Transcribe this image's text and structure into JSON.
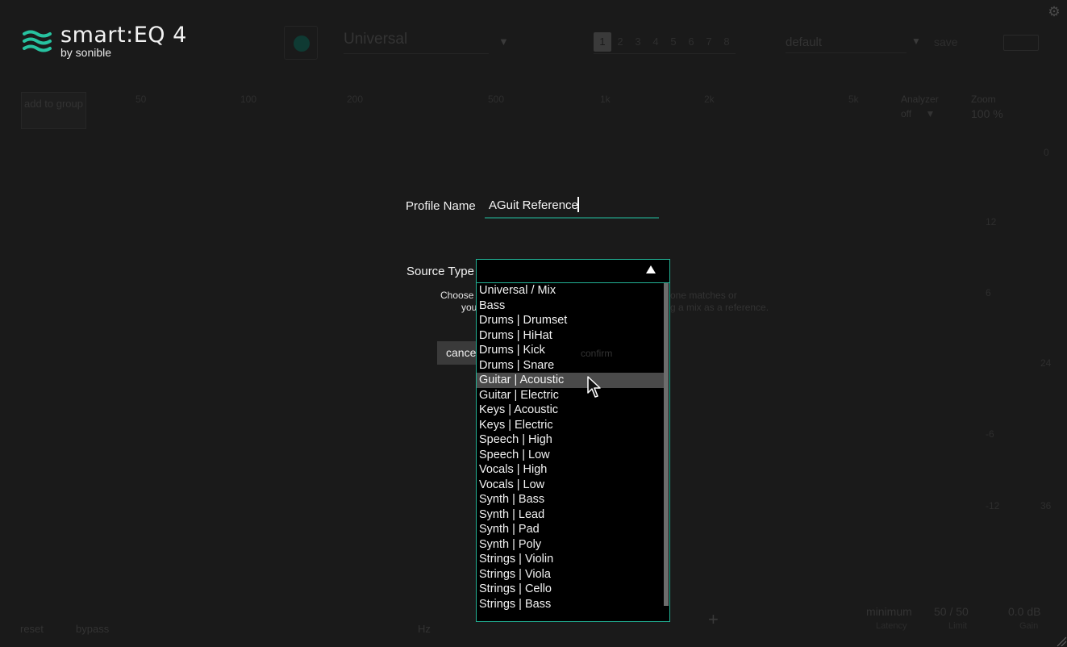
{
  "header": {
    "logo_title": "smart:EQ 4",
    "logo_by": "by sonible",
    "profile": "Universal",
    "slots": [
      "1",
      "2",
      "3",
      "4",
      "5",
      "6",
      "7",
      "8"
    ],
    "preset": "default",
    "save_label": "save"
  },
  "controls": {
    "add_to_group": "add to group",
    "freq_labels": [
      "50",
      "100",
      "200",
      "500",
      "1k",
      "2k",
      "5k"
    ],
    "analyzer_label": "Analyzer",
    "analyzer_value": "off",
    "zoom_label": "Zoom",
    "zoom_value": "100 %",
    "db_labels": [
      "0",
      "12",
      "6",
      "24",
      "-6",
      "-12",
      "36"
    ]
  },
  "bottom": {
    "reset": "reset",
    "bypass": "bypass",
    "hz": "Hz",
    "minimum": "minimum",
    "minimum_cap": "Latency",
    "limit": "50 / 50",
    "limit_cap": "Limit",
    "gain": "0.0 dB",
    "gain_cap": "Gain"
  },
  "dialog": {
    "profile_name_label": "Profile Name",
    "profile_name_value": "AGuit Reference",
    "source_type_label": "Source Type",
    "hint_line1": "Choose",
    "hint_line1_tail": "one matches or",
    "hint_line2": "you",
    "hint_line2_tail": "g a mix as a reference.",
    "cancel_label": "cancel",
    "confirm_label": "confirm",
    "source_options": [
      "Universal / Mix",
      "Bass",
      "Drums | Drumset",
      "Drums | HiHat",
      "Drums | Kick",
      "Drums | Snare",
      "Guitar | Acoustic",
      "Guitar | Electric",
      "Keys | Acoustic",
      "Keys | Electric",
      "Speech | High",
      "Speech | Low",
      "Vocals | High",
      "Vocals | Low",
      "Synth | Bass",
      "Synth | Lead",
      "Synth | Pad",
      "Synth | Poly",
      "Strings | Violin",
      "Strings | Viola",
      "Strings | Cello",
      "Strings | Bass"
    ],
    "hovered_option": "Guitar | Acoustic"
  },
  "icons": {
    "logo": "sonible-waves-icon",
    "settings": "gear-icon",
    "dropdown_arrow": "triangle-up-icon",
    "cursor": "mouse-pointer-icon"
  },
  "colors": {
    "accent": "#22b094",
    "logo_accent": "#27c2a0",
    "background": "#1a1a1a",
    "list_bg": "#000000",
    "hover": "#4a4a4a"
  }
}
